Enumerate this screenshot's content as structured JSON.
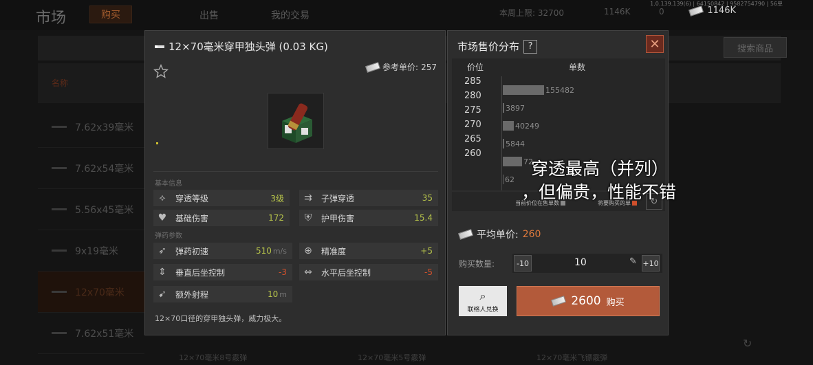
{
  "background": {
    "title": "市场",
    "tabs": [
      "购买",
      "出售",
      "我的交易"
    ],
    "stats": [
      "本周上限: 32700",
      "1146K",
      "0"
    ],
    "version": "1.0.139.139(6) | 64150842 | 9582754790 | 56单",
    "money": "1146K",
    "search_button": "搜索商品",
    "header_text": "名称",
    "list": [
      "7.62x39毫米",
      "7.62x54毫米",
      "5.56x45毫米",
      "9x19毫米",
      "12x70毫米",
      "7.62x51毫米"
    ],
    "selected_index": 4,
    "bottom_items": [
      "12×70毫米8号霰弹",
      "12×70毫米5号霰弹",
      "12×70毫米飞镖霰弹"
    ]
  },
  "item": {
    "title": "12×70毫米穿甲独头弹 (0.03 KG)",
    "ref_price_label": "参考单价:",
    "ref_price": "257",
    "basic_info_label": "基本信息",
    "ammo_params_label": "弹药参数",
    "stats": [
      {
        "name": "穿透等级",
        "value": "3级",
        "color": "green",
        "icon": "penetration-icon"
      },
      {
        "name": "子弹穿透",
        "value": "35",
        "color": "green",
        "icon": "bullet-penetration-icon"
      },
      {
        "name": "基础伤害",
        "value": "172",
        "color": "green",
        "icon": "broken-heart-icon"
      },
      {
        "name": "护甲伤害",
        "value": "15.4",
        "color": "green",
        "icon": "armor-damage-icon"
      },
      {
        "name": "弹药初速",
        "value": "510",
        "unit": "m/s",
        "color": "green",
        "icon": "rocket-icon"
      },
      {
        "name": "精准度",
        "value": "+5",
        "color": "green",
        "icon": "crosshair-icon"
      },
      {
        "name": "垂直后坐控制",
        "value": "-3",
        "color": "red",
        "icon": "vertical-recoil-icon"
      },
      {
        "name": "水平后坐控制",
        "value": "-5",
        "color": "red",
        "icon": "horizontal-recoil-icon"
      },
      {
        "name": "额外射程",
        "value": "10",
        "unit": "m",
        "color": "green",
        "icon": "range-icon"
      }
    ],
    "description": "12×70口径的穿甲独头弹，威力极大。"
  },
  "market": {
    "title": "市场售价分布",
    "help": "?",
    "close": "✕",
    "col_price": "价位",
    "col_count": "单数",
    "legend_current": "当前价位在售单数",
    "legend_buy": "将要购买的单",
    "avg_label": "平均单价:",
    "avg_value": "260",
    "qty_label": "购买数量:",
    "qty_minus": "-10",
    "qty_value": "10",
    "qty_plus": "+10",
    "contact_label": "联络人兑换",
    "buy_price": "2600",
    "buy_label": "购买",
    "colors": {
      "accent": "#b35a3a",
      "avg": "#e07a3c",
      "bar": "#6a6a6a"
    }
  },
  "chart_data": {
    "type": "bar",
    "title": "市场售价分布",
    "xlabel": "价位",
    "ylabel": "单数",
    "y_ticks": [
      "285",
      "280",
      "275",
      "270",
      "265",
      "260"
    ],
    "bars": [
      {
        "value": 155482,
        "label": "155482"
      },
      {
        "value": 3897,
        "label": "3897"
      },
      {
        "value": 40249,
        "label": "40249"
      },
      {
        "value": 5844,
        "label": "5844"
      },
      {
        "value": 72000,
        "label": "72"
      },
      {
        "value": 62,
        "label": "62"
      }
    ]
  },
  "subtitle": {
    "line1": "穿透最高（并列）",
    "line2": "，但偏贵，性能不错"
  }
}
